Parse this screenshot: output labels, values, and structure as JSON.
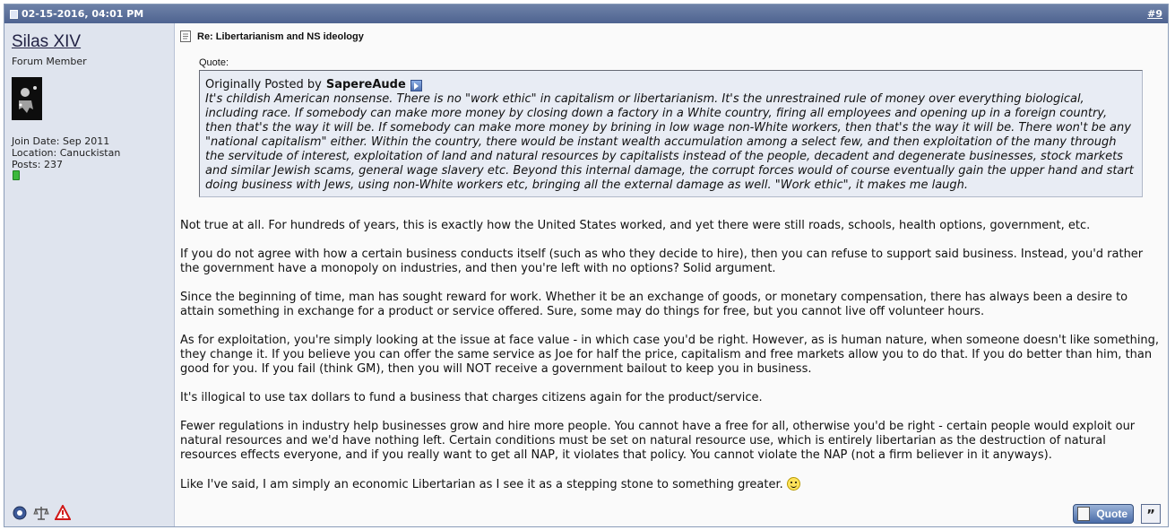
{
  "post": {
    "date": "02-15-2016, 04:01 PM",
    "number": "#9"
  },
  "user": {
    "name": "Silas XIV",
    "title": "Forum Member",
    "join_date": "Join Date: Sep 2011",
    "location": "Location: Canuckistan",
    "posts": "Posts: 237",
    "status": "online"
  },
  "message": {
    "title": "Re: Libertarianism and NS ideology",
    "quote_label": "Quote:",
    "quote_originally_posted_by": "Originally Posted by",
    "quote_author": "SapereAude",
    "quote_text": "It's childish American nonsense. There is no \"work ethic\" in capitalism or libertarianism. It's the unrestrained rule of money over everything biological, including race. If somebody can make more money by closing down a factory in a White country, firing all employees and opening up in a foreign country, then that's the way it will be. If somebody can make more money by brining in low wage non-White workers, then that's the way it will be. There won't be any \"national capitalism\" either. Within the country, there would be instant wealth accumulation among a select few, and then exploitation of the many through the servitude of interest, exploitation of land and natural resources by capitalists instead of the people, decadent and degenerate businesses, stock markets and similar Jewish scams, general wage slavery etc. Beyond this internal damage, the corrupt forces would of course eventually gain the upper hand and start doing business with Jews, using non-White workers etc, bringing all the external damage as well. \"Work ethic\", it makes me laugh.",
    "paragraphs": [
      "Not true at all. For hundreds of years, this is exactly how the United States worked, and yet there were still roads, schools, health options, government, etc.",
      "If you do not agree with how a certain business conducts itself (such as who they decide to hire), then you can refuse to support said business. Instead, you'd rather the government have a monopoly on industries, and then you're left with no options? Solid argument.",
      "Since the beginning of time, man has sought reward for work. Whether it be an exchange of goods, or monetary compensation, there has always been a desire to attain something in exchange for a product or service offered. Sure, some may do things for free, but you cannot live off volunteer hours.",
      "As for exploitation, you're simply looking at the issue at face value - in which case you'd be right. However, as is human nature, when someone doesn't like something, they change it. If you believe you can offer the same service as Joe for half the price, capitalism and free markets allow you to do that. If you do better than him, than good for you. If you fail (think GM), then you will NOT receive a government bailout to keep you in business.",
      "It's illogical to use tax dollars to fund a business that charges citizens again for the product/service.",
      "Fewer regulations in industry help businesses grow and hire more people. You cannot have a free for all, otherwise you'd be right - certain people would exploit our natural resources and we'd have nothing left. Certain conditions must be set on natural resource use, which is entirely libertarian as the destruction of natural resources effects everyone, and if you really want to get all NAP, it violates that policy. You cannot violate the NAP (not a firm believer in it anyways)."
    ],
    "last_paragraph": "Like I've said, I am simply an economic Libertarian as I see it as a stepping stone to something greater."
  },
  "buttons": {
    "quote_label": "Quote",
    "multi_quote_label": "”"
  },
  "icons": {
    "post_date": "document-icon",
    "title": "post-document-icon",
    "view_post": "view-post-arrow-icon",
    "smiley": "smile-icon",
    "sidebar": [
      "reputation-icon",
      "scales-icon",
      "report-warning-icon"
    ]
  },
  "colors": {
    "header": "#5a6f9a",
    "sidebar": "#dfe4ee",
    "quote_bg": "#e8ecf4",
    "online": "#3cb83c"
  }
}
